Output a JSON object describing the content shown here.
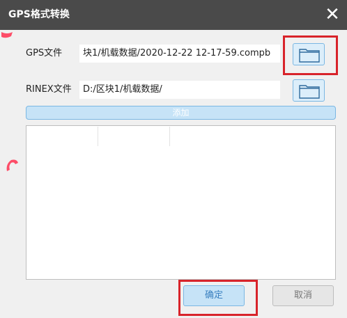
{
  "window": {
    "title": "GPS格式转换",
    "close_label": "✕"
  },
  "gps": {
    "label": "GPS文件",
    "value": "块1/机载数据/2020-12-22 12-17-59.compb"
  },
  "rinex": {
    "label": "RINEX文件",
    "value": "D:/区块1/机载数据/"
  },
  "add_label": "添加",
  "list": {
    "columns": [
      "",
      "",
      ""
    ],
    "rows": []
  },
  "buttons": {
    "ok": "确定",
    "cancel": "取消"
  },
  "colors": {
    "titlebar": "#4a4a4a",
    "accent": "#7ab7e3",
    "highlight": "#d8232a"
  },
  "icons": {
    "folder": "folder-icon",
    "close": "close-icon"
  }
}
